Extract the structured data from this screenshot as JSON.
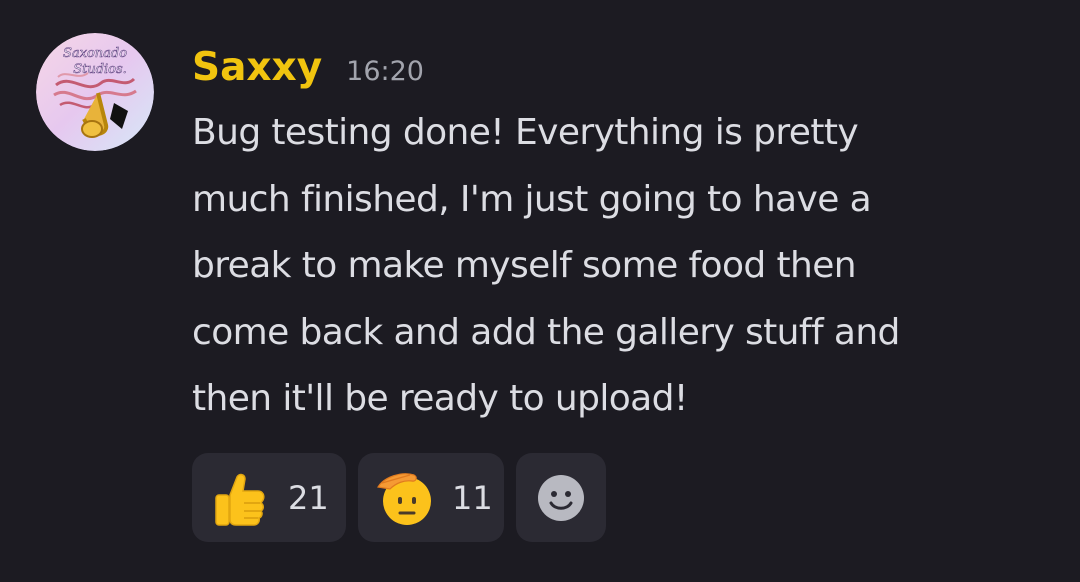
{
  "message": {
    "author": "Saxxy",
    "timestamp": "16:20",
    "text": "Bug testing done! Everything is pretty\nmuch finished, I'm just going to have a\nbreak to make myself some food then\ncome back and add the gallery stuff and\nthen it'll be ready to upload!",
    "avatar_logo_text": "Saxonado Studios",
    "author_color": "#f1c40f"
  },
  "reactions": [
    {
      "emoji": "thumbs-up",
      "count": "21"
    },
    {
      "emoji": "saluting-face",
      "count": "11"
    }
  ],
  "add_reaction": {
    "icon": "add-reaction-smiley-icon"
  }
}
